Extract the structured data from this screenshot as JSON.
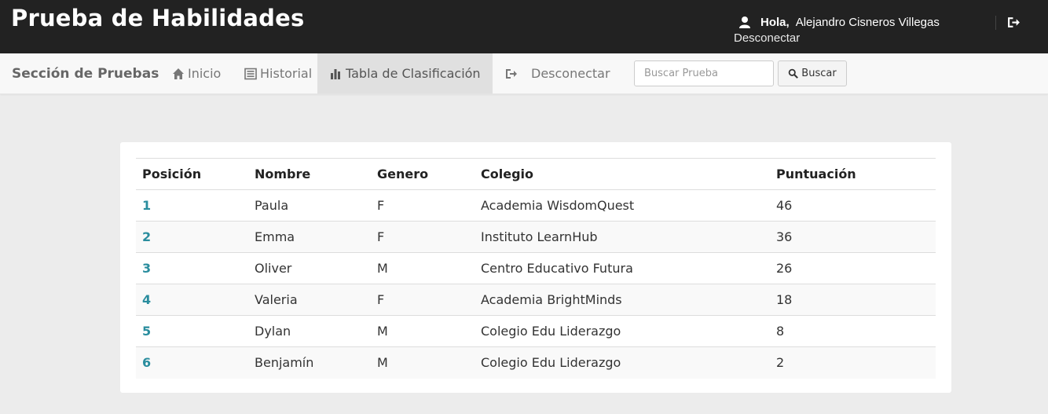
{
  "header": {
    "title": "Prueba de Habilidades",
    "greeting": "Hola,",
    "username": "Alejandro Cisneros Villegas",
    "logout_text": "Desconectar"
  },
  "nav": {
    "brand": "Sección de Pruebas",
    "items": [
      {
        "label": "Inicio",
        "icon": "home-icon"
      },
      {
        "label": "Historial",
        "icon": "list-icon"
      },
      {
        "label": "Tabla de Clasificación",
        "icon": "bar-chart-icon",
        "active": true
      },
      {
        "label": "Desconectar",
        "icon": "logout-icon"
      }
    ],
    "search_placeholder": "Buscar Prueba",
    "search_button": "Buscar"
  },
  "table": {
    "headers": [
      "Posición",
      "Nombre",
      "Genero",
      "Colegio",
      "Puntuación"
    ],
    "rows": [
      [
        "1",
        "Paula",
        "F",
        "Academia WisdomQuest",
        "46"
      ],
      [
        "2",
        "Emma",
        "F",
        "Instituto LearnHub",
        "36"
      ],
      [
        "3",
        "Oliver",
        "M",
        "Centro Educativo Futura",
        "26"
      ],
      [
        "4",
        "Valeria",
        "F",
        "Academia BrightMinds",
        "18"
      ],
      [
        "5",
        "Dylan",
        "M",
        "Colegio Edu Liderazgo",
        "8"
      ],
      [
        "6",
        "Benjamín",
        "M",
        "Colegio Edu Liderazgo",
        "2"
      ]
    ]
  },
  "colors": {
    "topbar": "#222222",
    "navbar": "#f8f8f8",
    "active_tab": "#e0e0e0",
    "position_link": "#2a8d9e",
    "page_bg": "#ececec"
  }
}
